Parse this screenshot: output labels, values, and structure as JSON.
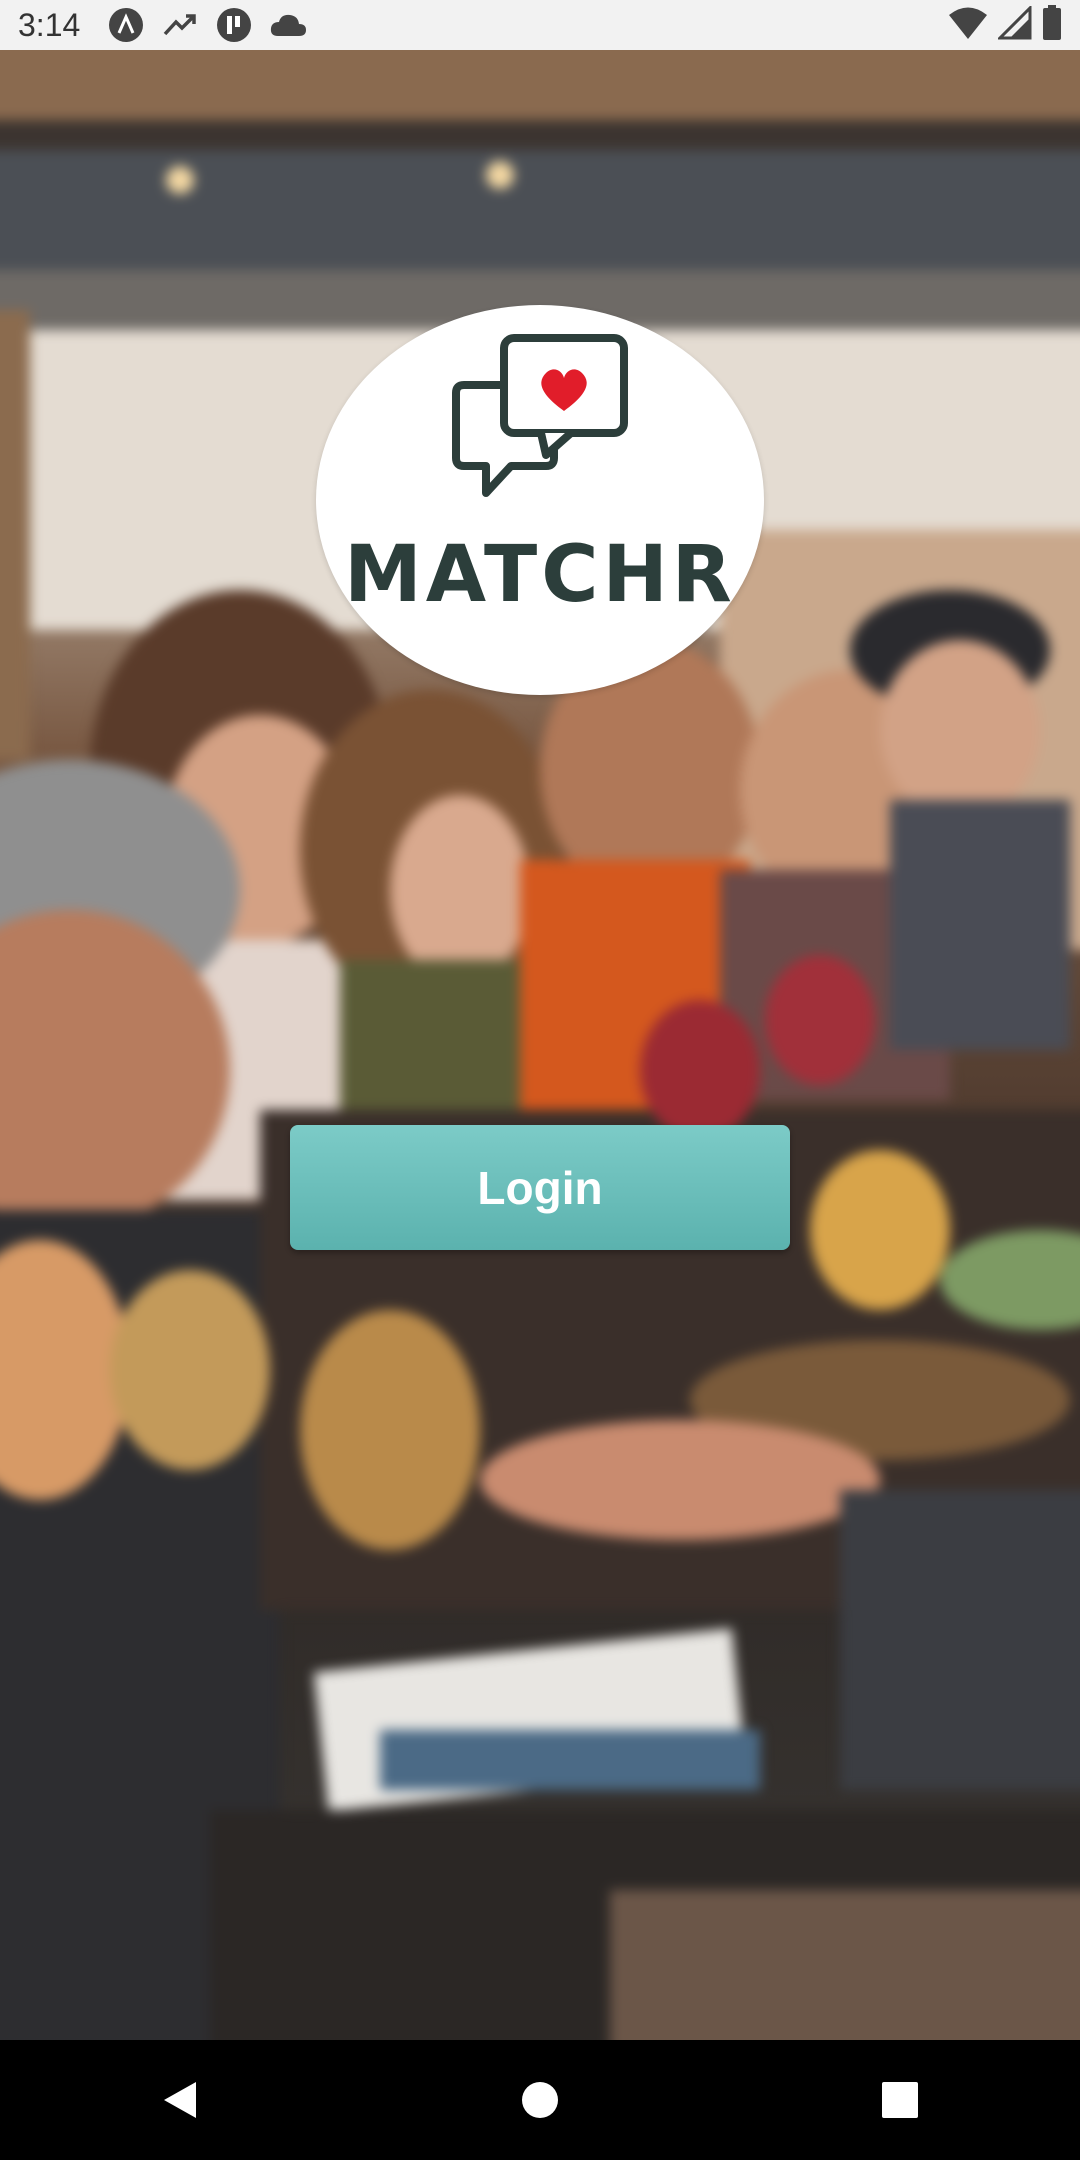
{
  "status_bar": {
    "time": "3:14",
    "left_icons": [
      "arch-logo-icon",
      "trending-up-icon",
      "gauge-app-icon",
      "cloud-icon"
    ],
    "right_icons": [
      "wifi-icon",
      "cell-signal-icon",
      "battery-icon"
    ]
  },
  "background": {
    "description_icon": "restaurant-photo"
  },
  "logo": {
    "icon": "chat-bubbles-heart-icon",
    "text": "MATCHR",
    "colors": {
      "text": "#2c3e3b",
      "heart": "#e11d2a",
      "bubble_outline": "#2c3e3b"
    }
  },
  "login": {
    "label": "Login",
    "color": "#6bbfbb"
  },
  "nav_bar": {
    "buttons": [
      "back-icon",
      "home-icon",
      "recents-icon"
    ]
  }
}
